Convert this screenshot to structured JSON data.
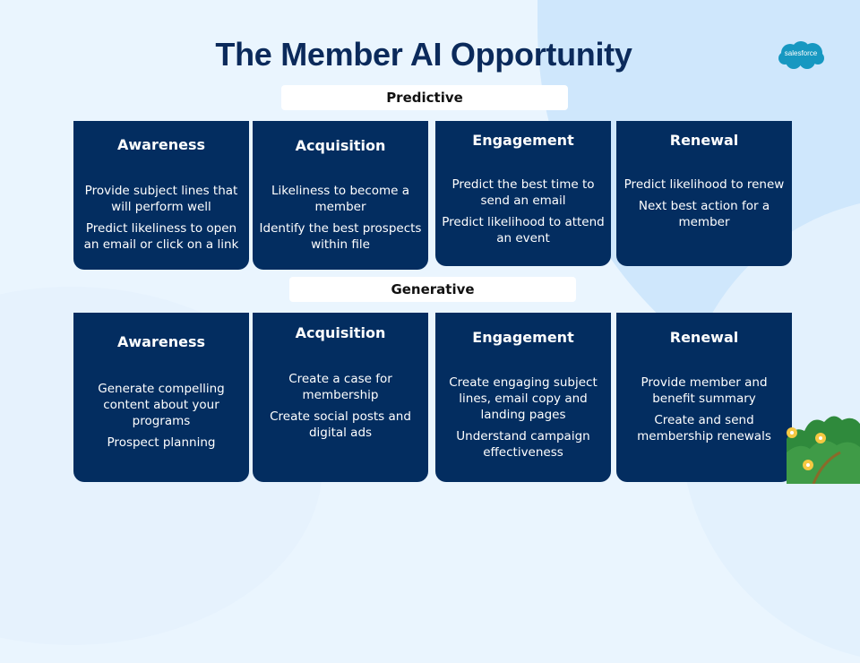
{
  "slide": {
    "title": "The Member AI Opportunity",
    "logo": {
      "icon": "salesforce-cloud-logo",
      "text": "salesforce",
      "color": "#1798c1"
    },
    "colors": {
      "card": "#032d60",
      "title": "#0b2a5b",
      "pill": "#ffffff",
      "background": "#eaf5fe"
    }
  },
  "sections": [
    {
      "label": "Predictive",
      "cards": [
        {
          "heading": "Awareness",
          "items": [
            "Provide subject lines that will perform well",
            "Predict likeliness to open an email or click on a link"
          ]
        },
        {
          "heading": "Acquisition",
          "items": [
            "Likeliness to become a member",
            "Identify the best prospects within file"
          ]
        },
        {
          "heading": "Engagement",
          "items": [
            "Predict the best time to send an email",
            "Predict likelihood to attend an event"
          ]
        },
        {
          "heading": "Renewal",
          "items": [
            "Predict likelihood to renew",
            "Next best action for a member"
          ]
        }
      ]
    },
    {
      "label": "Generative",
      "cards": [
        {
          "heading": "Awareness",
          "items": [
            "Generate compelling content about your programs",
            "Prospect planning"
          ]
        },
        {
          "heading": "Acquisition",
          "items": [
            "Create a case for membership",
            "Create social posts and digital ads"
          ]
        },
        {
          "heading": "Engagement",
          "items": [
            "Create engaging subject lines, email copy and landing pages",
            "Understand campaign effectiveness"
          ]
        },
        {
          "heading": "Renewal",
          "items": [
            "Provide member and benefit summary",
            "Create and send membership renewals"
          ]
        }
      ]
    }
  ]
}
